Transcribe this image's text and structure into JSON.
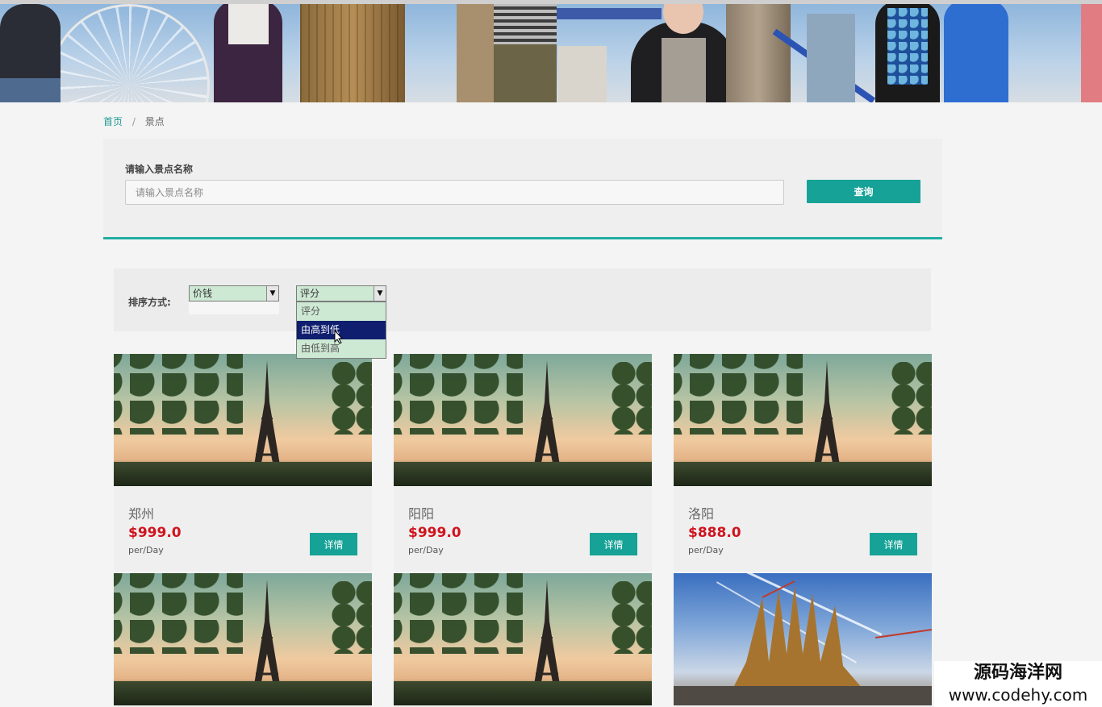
{
  "breadcrumb": {
    "home": "首页",
    "separator": "/",
    "current": "景点"
  },
  "search": {
    "label": "请输入景点名称",
    "placeholder": "请输入景点名称",
    "button": "查询"
  },
  "sort": {
    "label": "排序方式:",
    "price_select": {
      "value": "价钱"
    },
    "rating_select": {
      "value": "评分",
      "options": [
        "评分",
        "由高到低",
        "由低到高"
      ],
      "highlighted": "由高到低"
    }
  },
  "cards": [
    {
      "name": "郑州",
      "price": "$999.0",
      "unit": "per/Day",
      "button": "详情",
      "image": "eiffel-tower"
    },
    {
      "name": "阳阳",
      "price": "$999.0",
      "unit": "per/Day",
      "button": "详情",
      "image": "eiffel-tower"
    },
    {
      "name": "洛阳",
      "price": "$888.0",
      "unit": "per/Day",
      "button": "详情",
      "image": "eiffel-tower"
    },
    {
      "image": "eiffel-tower"
    },
    {
      "image": "eiffel-tower"
    },
    {
      "image": "sagrada-familia"
    }
  ],
  "watermark": {
    "name": "源码海洋网",
    "url": "www.codehy.com"
  },
  "colors": {
    "accent": "#16a296",
    "price": "#d0141f",
    "selected_option": "#0f1e6e"
  }
}
